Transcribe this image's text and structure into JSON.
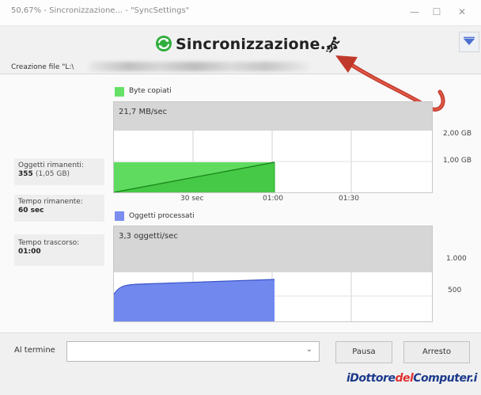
{
  "window": {
    "title": "50,67% - Sincronizzazione... - \"SyncSettings\"",
    "minimize_symbol": "—",
    "maximize_symbol": "☐",
    "close_symbol": "✕"
  },
  "header": {
    "status_title": "Sincronizzazione...",
    "file_label": "Creazione file \"L:\\",
    "sync_icon": "sync-arrows-icon",
    "runner_icon": "running-figure-icon",
    "collapse_icon": "arrow-down-icon"
  },
  "stats": {
    "remaining_objects": {
      "label": "Oggetti rimanenti:",
      "value": "355",
      "detail": "(1,05 GB)"
    },
    "remaining_time": {
      "label": "Tempo rimanente:",
      "value": "60 sec"
    },
    "elapsed_time": {
      "label": "Tempo trascorso:",
      "value": "01:00"
    }
  },
  "bytes_graph": {
    "legend": "Byte copiati",
    "rate": "21,7 MB/sec",
    "color": "#66e066",
    "y_labels": [
      "2,00 GB",
      "1,00 GB"
    ],
    "x_labels": [
      "30 sec",
      "01:00",
      "01:30"
    ]
  },
  "items_graph": {
    "legend": "Oggetti processati",
    "rate": "3,3 oggetti/sec",
    "color": "#7b8ef0",
    "y_labels": [
      "1.000",
      "500"
    ]
  },
  "footer": {
    "on_finish_label": "Al termine",
    "on_finish_value": "",
    "pause_label": "Pausa",
    "stop_label": "Arresto",
    "dropdown_icon": "chevron-down-icon"
  },
  "watermark": {
    "parts": [
      "iDottore",
      "del",
      "Computer.i"
    ],
    "colors": [
      "#1c3a8c",
      "#e03030",
      "#1c3a8c"
    ]
  }
}
